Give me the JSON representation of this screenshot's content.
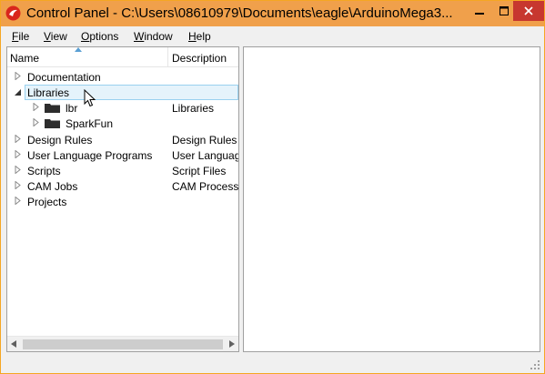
{
  "window": {
    "title": "Control Panel - C:\\Users\\08610979\\Documents\\eagle\\ArduinoMega3..."
  },
  "menu": {
    "file": "File",
    "view": "View",
    "options": "Options",
    "window": "Window",
    "help": "Help"
  },
  "tree": {
    "columns": {
      "name": "Name",
      "description": "Description"
    },
    "rows": [
      {
        "label": "Documentation",
        "description": "",
        "expander": "collapsed"
      },
      {
        "label": "Libraries",
        "description": "",
        "expander": "expanded",
        "selected": true
      },
      {
        "label": "lbr",
        "description": "Libraries",
        "expander": "collapsed",
        "icon": "folder-icon"
      },
      {
        "label": "SparkFun",
        "description": "",
        "expander": "collapsed",
        "icon": "folder-icon"
      },
      {
        "label": "Design Rules",
        "description": "Design Rules",
        "expander": "collapsed"
      },
      {
        "label": "User Language Programs",
        "description": "User Language Programs",
        "expander": "collapsed"
      },
      {
        "label": "Scripts",
        "description": "Script Files",
        "expander": "collapsed"
      },
      {
        "label": "CAM Jobs",
        "description": "CAM Processor Jobs",
        "expander": "collapsed"
      },
      {
        "label": "Projects",
        "description": "",
        "expander": "collapsed"
      }
    ]
  },
  "colors": {
    "titlebar": "#f0a04b",
    "selection_bg": "#e5f3fb",
    "selection_border": "#99d1ef"
  }
}
